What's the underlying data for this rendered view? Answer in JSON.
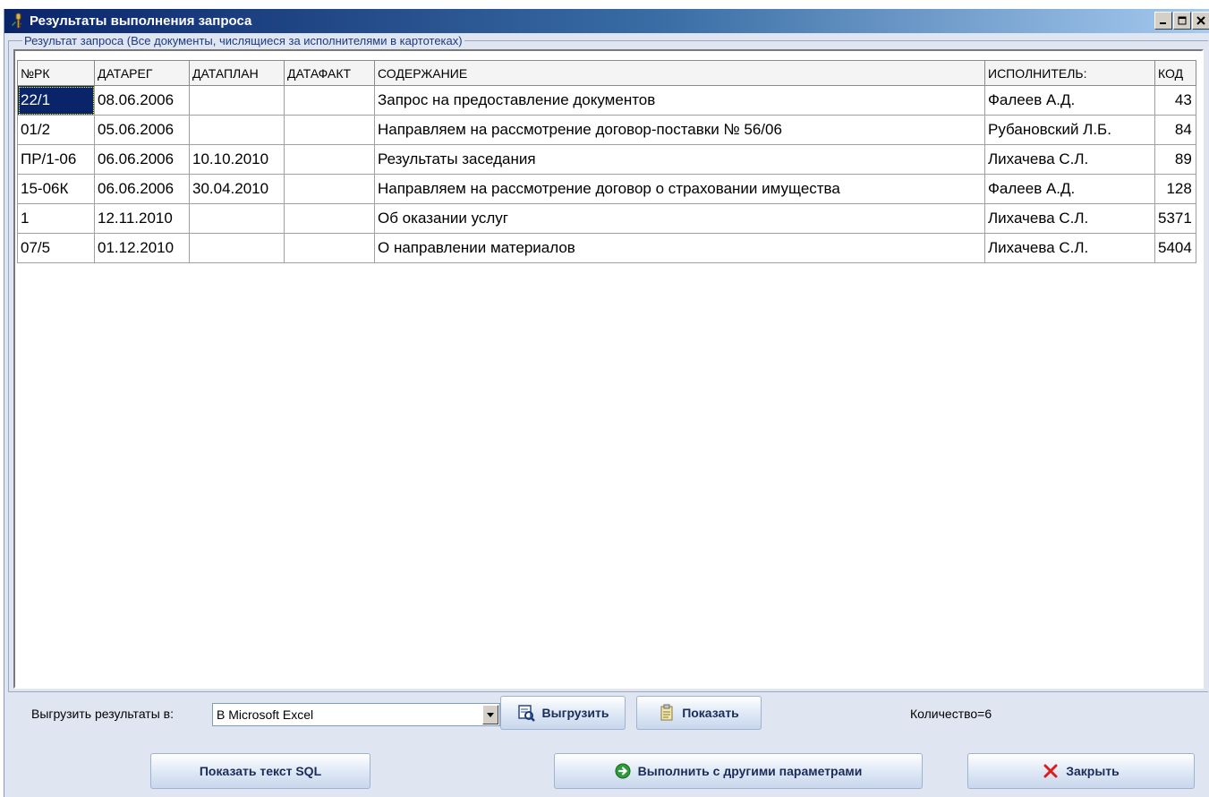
{
  "window": {
    "title": "Результаты выполнения запроса"
  },
  "group": {
    "title": "Результат запроса (Все документы, числящиеся за исполнителями в картотеках)"
  },
  "table": {
    "columns": [
      "№РК",
      "ДАТАРЕГ",
      "ДАТАПЛАН",
      "ДАТАФАКТ",
      "СОДЕРЖАНИЕ",
      "ИСПОЛНИТЕЛЬ:",
      "КОД"
    ],
    "rows": [
      [
        "22/1",
        "08.06.2006",
        "",
        "",
        "Запрос на предоставление документов",
        "Фалеев А.Д.",
        "43"
      ],
      [
        "01/2",
        "05.06.2006",
        "",
        "",
        "Направляем на рассмотрение договор-поставки № 56/06",
        "Рубановский Л.Б.",
        "84"
      ],
      [
        "ПР/1-06",
        "06.06.2006",
        "10.10.2010",
        "",
        "Результаты заседания",
        "Лихачева С.Л.",
        "89"
      ],
      [
        "15-06К",
        "06.06.2006",
        "30.04.2010",
        "",
        "Направляем на рассмотрение договор о страховании имущества",
        "Фалеев А.Д.",
        "128"
      ],
      [
        "1",
        "12.11.2010",
        "",
        "",
        "Об оказании услуг",
        "Лихачева С.Л.",
        "5371"
      ],
      [
        "07/5",
        "01.12.2010",
        "",
        "",
        "О направлении материалов",
        "Лихачева С.Л.",
        "5404"
      ]
    ]
  },
  "export": {
    "label": "Выгрузить результаты в:",
    "selected": "В Microsoft Excel",
    "export_button": "Выгрузить",
    "show_button": "Показать"
  },
  "count_text": "Количество=6",
  "buttons": {
    "show_sql": "Показать текст SQL",
    "run_other": "Выполнить с другими параметрами",
    "close": "Закрыть"
  },
  "icons": {
    "app": "key-icon",
    "export": "export-icon",
    "show": "document-icon",
    "run": "go-arrow-icon",
    "close": "close-x-icon"
  }
}
